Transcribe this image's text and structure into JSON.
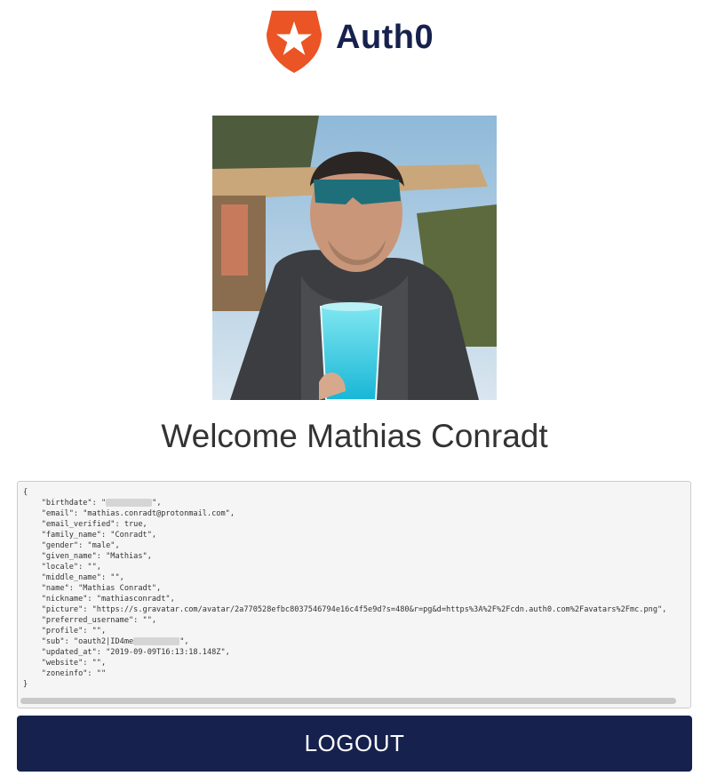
{
  "brand": {
    "name": "Auth0",
    "color": "#16214d",
    "logo_color": "#eb5424"
  },
  "profile": {
    "welcome": "Welcome Mathias Conradt",
    "json_lines": [
      "{",
      "    \"birthdate\": \"[redacted]\",",
      "    \"email\": \"mathias.conradt@protonmail.com\",",
      "    \"email_verified\": true,",
      "    \"family_name\": \"Conradt\",",
      "    \"gender\": \"male\",",
      "    \"given_name\": \"Mathias\",",
      "    \"locale\": \"\",",
      "    \"middle_name\": \"\",",
      "    \"name\": \"Mathias Conradt\",",
      "    \"nickname\": \"mathiasconradt\",",
      "    \"picture\": \"https://s.gravatar.com/avatar/2a770528efbc8037546794e16c4f5e9d?s=480&r=pg&d=https%3A%2F%2Fcdn.auth0.com%2Favatars%2Fmc.png\",",
      "    \"preferred_username\": \"\",",
      "    \"profile\": \"\",",
      "    \"sub\": \"oauth2|ID4me[redacted]\",",
      "    \"updated_at\": \"2019-09-09T16:13:18.148Z\",",
      "    \"website\": \"\",",
      "    \"zoneinfo\": \"\"",
      "}"
    ]
  },
  "actions": {
    "logout_label": "LOGOUT"
  },
  "icons": {
    "logo": "auth0-shield-star-icon"
  }
}
